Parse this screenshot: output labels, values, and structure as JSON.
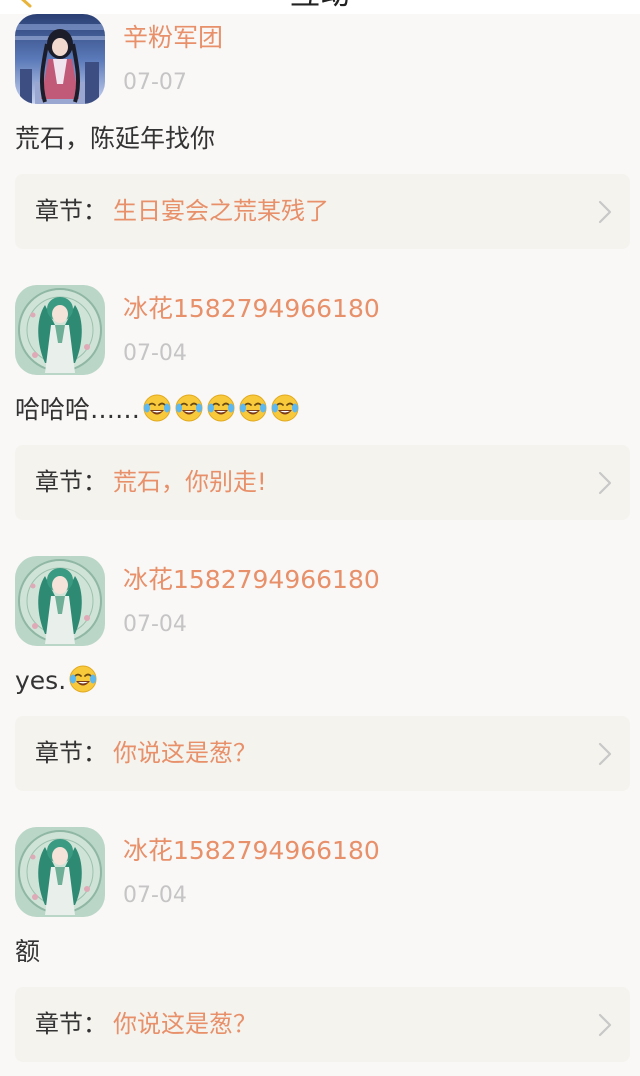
{
  "header": {
    "title": "互动"
  },
  "comments": [
    {
      "username": "辛粉军团",
      "date": "07-07",
      "text": "荒石，陈延年找你",
      "emoji_count": 0,
      "chapter_label": "章节：",
      "chapter_title": "生日宴会之荒某残了",
      "avatar": "anime-girl-city-avatar"
    },
    {
      "username": "冰花1582794966180",
      "date": "07-04",
      "text": "哈哈哈……",
      "emoji_count": 5,
      "chapter_label": "章节：",
      "chapter_title": "荒石，你别走!",
      "avatar": "anime-girl-green-hair-avatar"
    },
    {
      "username": "冰花1582794966180",
      "date": "07-04",
      "text": "yes.",
      "emoji_count": 1,
      "chapter_label": "章节：",
      "chapter_title": "你说这是葱？",
      "avatar": "anime-girl-green-hair-avatar"
    },
    {
      "username": "冰花1582794966180",
      "date": "07-04",
      "text": "额",
      "emoji_count": 0,
      "chapter_label": "章节：",
      "chapter_title": "你说这是葱？",
      "avatar": "anime-girl-green-hair-avatar"
    }
  ],
  "colors": {
    "accent": "#e7906a",
    "date": "#c5c5c5",
    "chapter_bg": "#f4f3ee",
    "page_bg": "#faf8f7"
  }
}
